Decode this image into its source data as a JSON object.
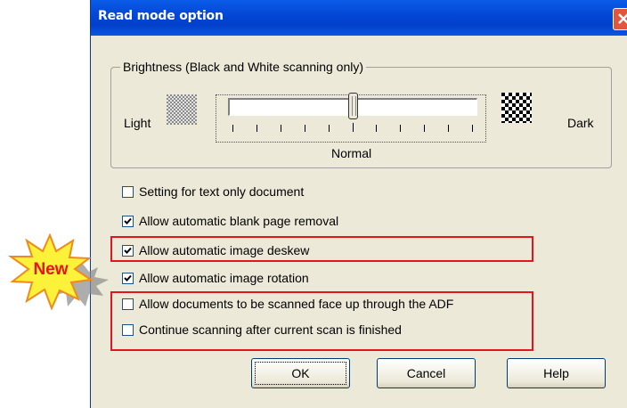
{
  "dialog": {
    "title": "Read mode option",
    "close_icon": "close-icon"
  },
  "brightness": {
    "group_label": "Brightness (Black and White scanning only)",
    "light_label": "Light",
    "dark_label": "Dark",
    "normal_label": "Normal",
    "slider_position_fraction": 0.5,
    "tick_count": 11
  },
  "options": [
    {
      "label": "Setting for text only document",
      "checked": false
    },
    {
      "label": "Allow automatic blank page removal",
      "checked": true
    },
    {
      "label": "Allow automatic image deskew",
      "checked": true
    },
    {
      "label": "Allow automatic image rotation",
      "checked": true
    },
    {
      "label": "Allow documents to be scanned face up through the ADF",
      "checked": false
    },
    {
      "label": "Continue scanning after current scan is finished",
      "checked": false
    }
  ],
  "buttons": {
    "ok": "OK",
    "cancel": "Cancel",
    "help": "Help"
  },
  "badge": {
    "text": "New",
    "color": "#e4151c"
  },
  "colors": {
    "highlight": "#e4151c",
    "titlebar": "#0345d6",
    "dialog_bg": "#ece9d8"
  }
}
